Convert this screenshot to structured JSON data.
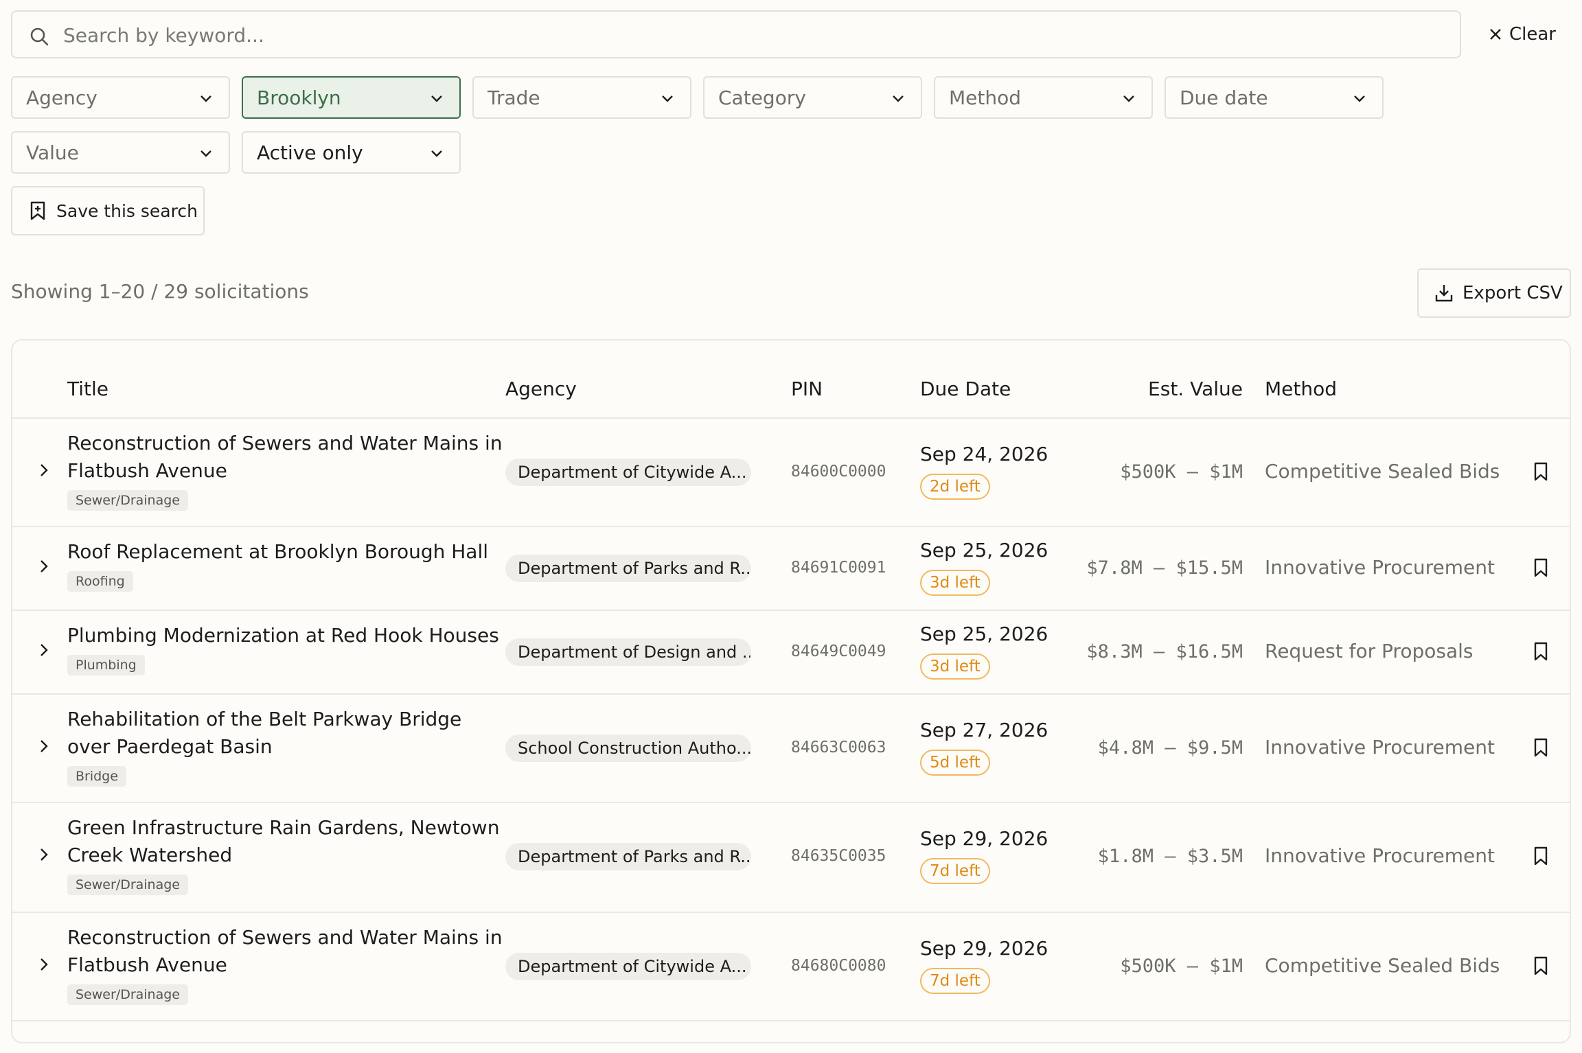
{
  "search": {
    "placeholder": "Search by keyword...",
    "value": ""
  },
  "clear_label": "Clear",
  "filters": {
    "agency": "Agency",
    "borough": "Brooklyn",
    "trade": "Trade",
    "category": "Category",
    "method": "Method",
    "due_date": "Due date",
    "value": "Value",
    "status": "Active only"
  },
  "save_search_label": "Save this search",
  "results_summary": "Showing 1–20 / 29 solicitations",
  "export_label": "Export CSV",
  "columns": {
    "title": "Title",
    "agency": "Agency",
    "pin": "PIN",
    "due_date": "Due Date",
    "est_value": "Est. Value",
    "method": "Method"
  },
  "rows": [
    {
      "title": "Reconstruction of Sewers and Water Mains in Flatbush Avenue",
      "tag": "Sewer/Drainage",
      "agency": "Department of Citywide A...",
      "pin": "84600C0000",
      "due": "Sep 24, 2026",
      "left": "2d left",
      "value": "$500K – $1M",
      "method": "Competitive Sealed Bids"
    },
    {
      "title": "Roof Replacement at Brooklyn Borough Hall",
      "tag": "Roofing",
      "agency": "Department of Parks and R...",
      "pin": "84691C0091",
      "due": "Sep 25, 2026",
      "left": "3d left",
      "value": "$7.8M – $15.5M",
      "method": "Innovative Procurement"
    },
    {
      "title": "Plumbing Modernization at Red Hook Houses",
      "tag": "Plumbing",
      "agency": "Department of Design and ...",
      "pin": "84649C0049",
      "due": "Sep 25, 2026",
      "left": "3d left",
      "value": "$8.3M – $16.5M",
      "method": "Request for Proposals"
    },
    {
      "title": "Rehabilitation of the Belt Parkway Bridge over Paerdegat Basin",
      "tag": "Bridge",
      "agency": "School Construction Autho...",
      "pin": "84663C0063",
      "due": "Sep 27, 2026",
      "left": "5d left",
      "value": "$4.8M – $9.5M",
      "method": "Innovative Procurement"
    },
    {
      "title": "Green Infrastructure Rain Gardens, Newtown Creek Watershed",
      "tag": "Sewer/Drainage",
      "agency": "Department of Parks and R...",
      "pin": "84635C0035",
      "due": "Sep 29, 2026",
      "left": "7d left",
      "value": "$1.8M – $3.5M",
      "method": "Innovative Procurement"
    },
    {
      "title": "Reconstruction of Sewers and Water Mains in Flatbush Avenue",
      "tag": "Sewer/Drainage",
      "agency": "Department of Citywide A...",
      "pin": "84680C0080",
      "due": "Sep 29, 2026",
      "left": "7d left",
      "value": "$500K – $1M",
      "method": "Competitive Sealed Bids"
    }
  ]
}
